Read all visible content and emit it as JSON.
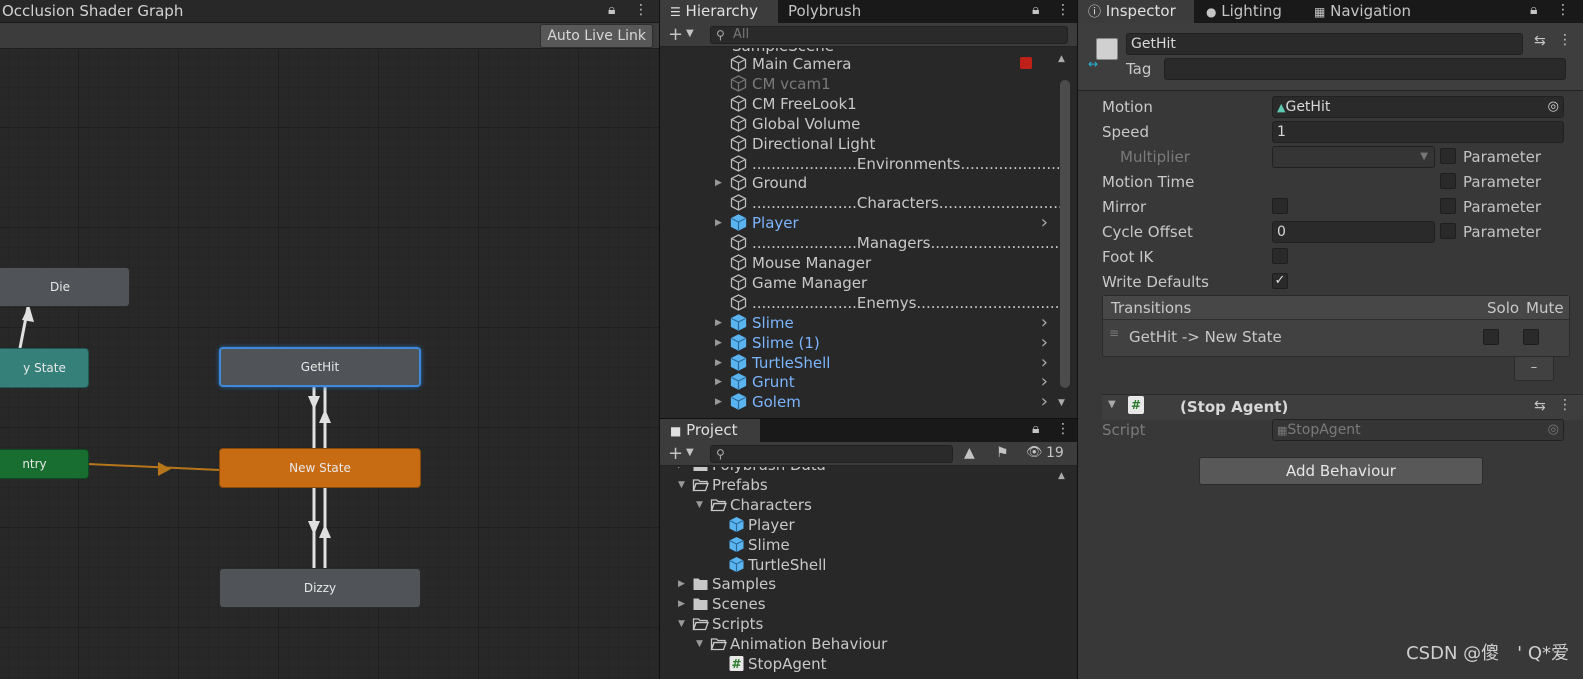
{
  "animator": {
    "title": "Occlusion Shader Graph",
    "auto_live_link": "Auto Live Link",
    "nodes": {
      "die": "Die",
      "partial_state": "y State",
      "entry": "ntry",
      "gethit": "GetHit",
      "new_state": "New State",
      "dizzy": "Dizzy"
    }
  },
  "hierarchy": {
    "tabs": [
      "Hierarchy",
      "Polybrush"
    ],
    "search_placeholder": "All",
    "scene_label": "SampleScene",
    "items": [
      {
        "label": "Main Camera",
        "type": "object"
      },
      {
        "label": "CM vcam1",
        "type": "disabled"
      },
      {
        "label": "CM FreeLook1",
        "type": "object"
      },
      {
        "label": "Global Volume",
        "type": "object"
      },
      {
        "label": "Directional Light",
        "type": "object"
      },
      {
        "label": "......................Environments..............................",
        "type": "object"
      },
      {
        "label": "Ground",
        "type": "object"
      },
      {
        "label": "......................Characters................................",
        "type": "object"
      },
      {
        "label": "Player",
        "type": "prefab"
      },
      {
        "label": "......................Managers................................",
        "type": "object"
      },
      {
        "label": "Mouse Manager",
        "type": "object"
      },
      {
        "label": "Game Manager",
        "type": "object"
      },
      {
        "label": "......................Enemys...............................",
        "type": "object"
      },
      {
        "label": "Slime",
        "type": "prefab"
      },
      {
        "label": "Slime (1)",
        "type": "prefab"
      },
      {
        "label": "TurtleShell",
        "type": "prefab"
      },
      {
        "label": "Grunt",
        "type": "prefab"
      },
      {
        "label": "Golem",
        "type": "prefab"
      }
    ]
  },
  "project": {
    "tab": "Project",
    "hidden_count": "19",
    "items": [
      {
        "label": "Polybrush Data",
        "type": "folder"
      },
      {
        "label": "Prefabs",
        "type": "folder-open"
      },
      {
        "label": "Characters",
        "type": "folder-open"
      },
      {
        "label": "Player",
        "type": "prefab"
      },
      {
        "label": "Slime",
        "type": "prefab"
      },
      {
        "label": "TurtleShell",
        "type": "prefab"
      },
      {
        "label": "Samples",
        "type": "folder"
      },
      {
        "label": "Scenes",
        "type": "folder"
      },
      {
        "label": "Scripts",
        "type": "folder-open"
      },
      {
        "label": "Animation Behaviour",
        "type": "folder-open"
      },
      {
        "label": "StopAgent",
        "type": "script"
      }
    ]
  },
  "inspector": {
    "tabs": [
      "Inspector",
      "Lighting",
      "Navigation"
    ],
    "name": "GetHit",
    "tag_label": "Tag",
    "fields": {
      "motion_label": "Motion",
      "motion_value": "GetHit",
      "speed_label": "Speed",
      "speed_value": "1",
      "multiplier_label": "Multiplier",
      "motion_time_label": "Motion Time",
      "mirror_label": "Mirror",
      "cycle_offset_label": "Cycle Offset",
      "cycle_offset_value": "0",
      "foot_ik_label": "Foot IK",
      "write_defaults_label": "Write Defaults",
      "parameter_label": "Parameter"
    },
    "transitions": {
      "header": "Transitions",
      "solo": "Solo",
      "mute": "Mute",
      "row": "GetHit -> New State",
      "remove": "–"
    },
    "component": {
      "title": "(Stop Agent)",
      "script_label": "Script",
      "script_value": "StopAgent"
    },
    "add_behaviour": "Add Behaviour"
  },
  "watermark": "CSDN @傻　' Q*爱"
}
